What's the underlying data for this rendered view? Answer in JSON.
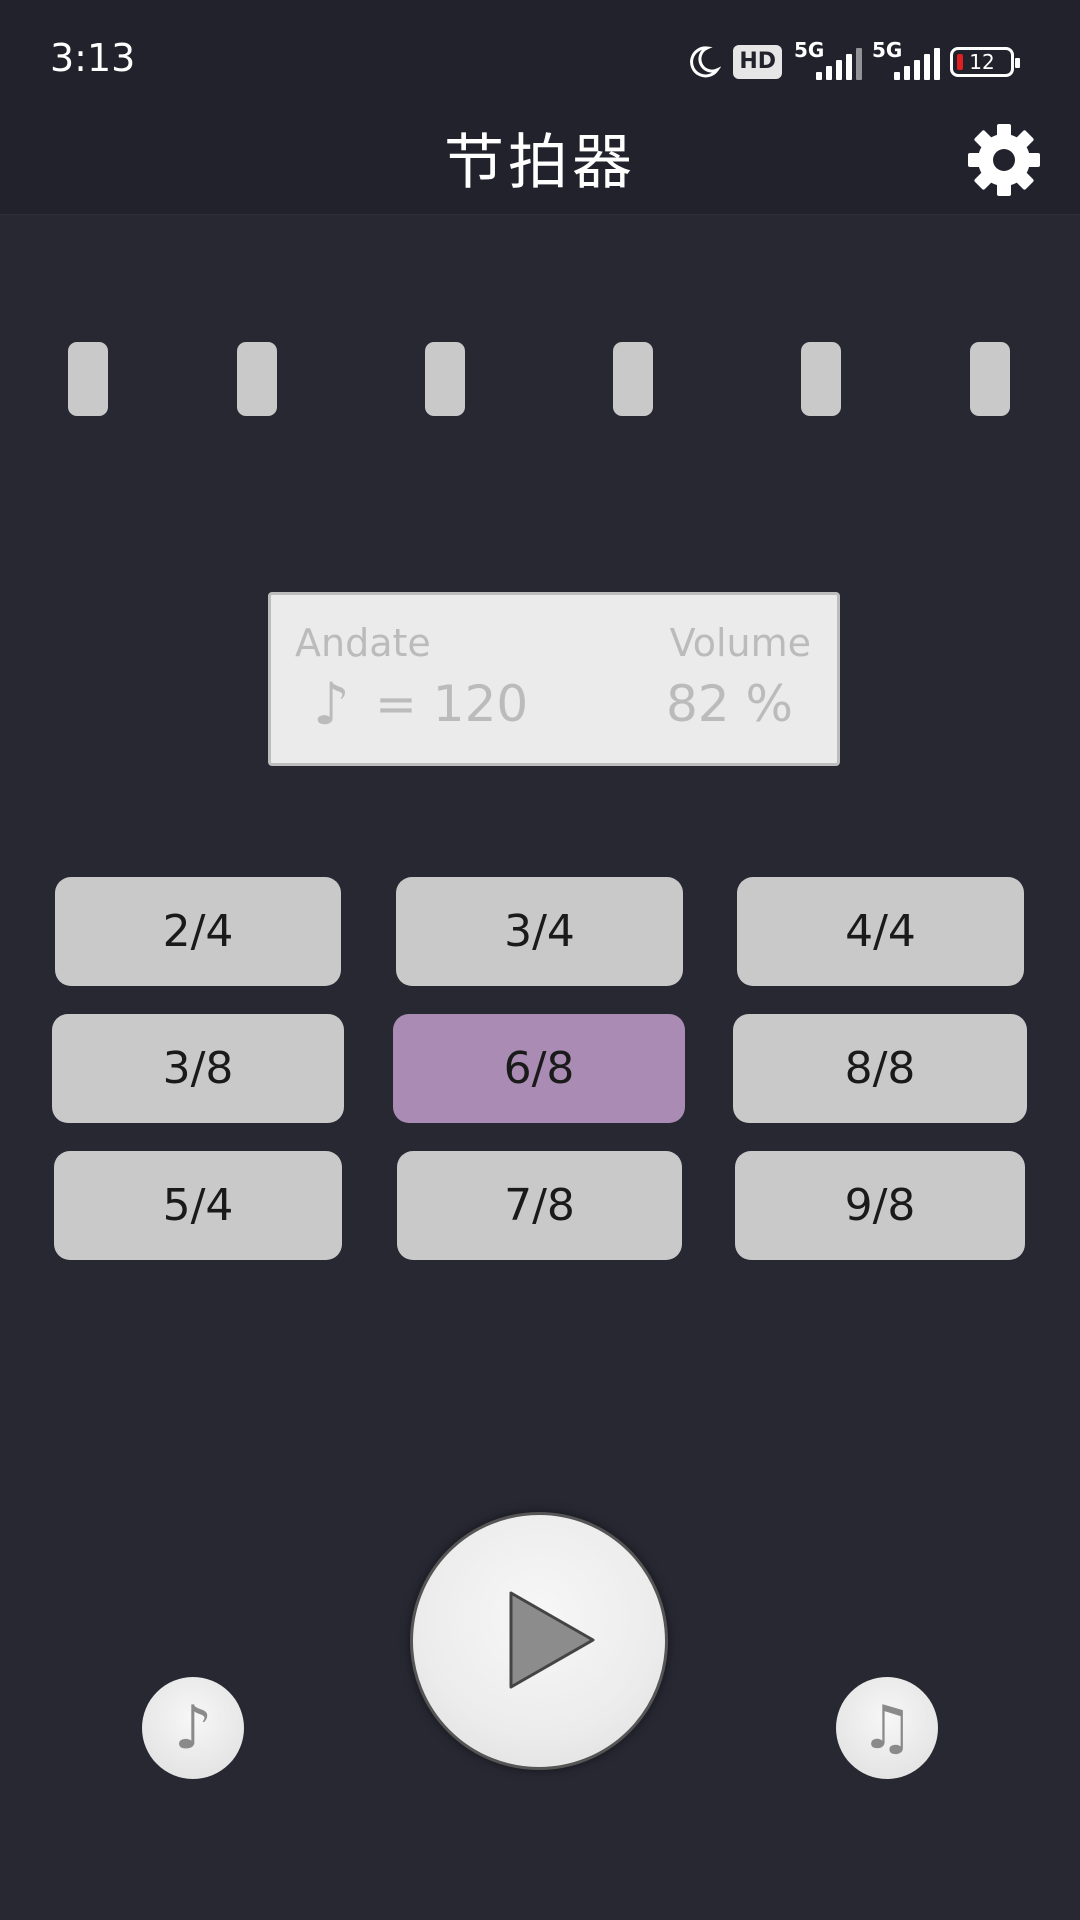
{
  "status_bar": {
    "time": "3:13",
    "hd_label": "HD",
    "net1_label": "5G",
    "net2_label": "5G",
    "battery_level": "12",
    "icons": [
      "moon-icon",
      "hd-icon",
      "signal-5g-icon",
      "signal-5g-icon",
      "battery-icon"
    ]
  },
  "header": {
    "title": "节拍器",
    "settings_icon": "gear-icon"
  },
  "beats": {
    "count": 6
  },
  "info": {
    "tempo_name": "Andate",
    "note_symbol": "♪",
    "bpm_text": "= 120",
    "volume_label": "Volume",
    "volume_value": "82 %"
  },
  "time_signatures": [
    {
      "label": "2/4",
      "active": false
    },
    {
      "label": "3/4",
      "active": false
    },
    {
      "label": "4/4",
      "active": false
    },
    {
      "label": "3/8",
      "active": false
    },
    {
      "label": "6/8",
      "active": true
    },
    {
      "label": "8/8",
      "active": false
    },
    {
      "label": "5/4",
      "active": false
    },
    {
      "label": "7/8",
      "active": false
    },
    {
      "label": "9/8",
      "active": false
    }
  ],
  "controls": {
    "left_icon": "single-note-icon",
    "left_glyph": "♪",
    "play_icon": "play-icon",
    "right_icon": "double-note-icon",
    "right_glyph": "♫"
  },
  "colors": {
    "background": "#282833",
    "header": "#22222c",
    "button": "#c9c9c9",
    "active_button": "#a98bb3"
  }
}
